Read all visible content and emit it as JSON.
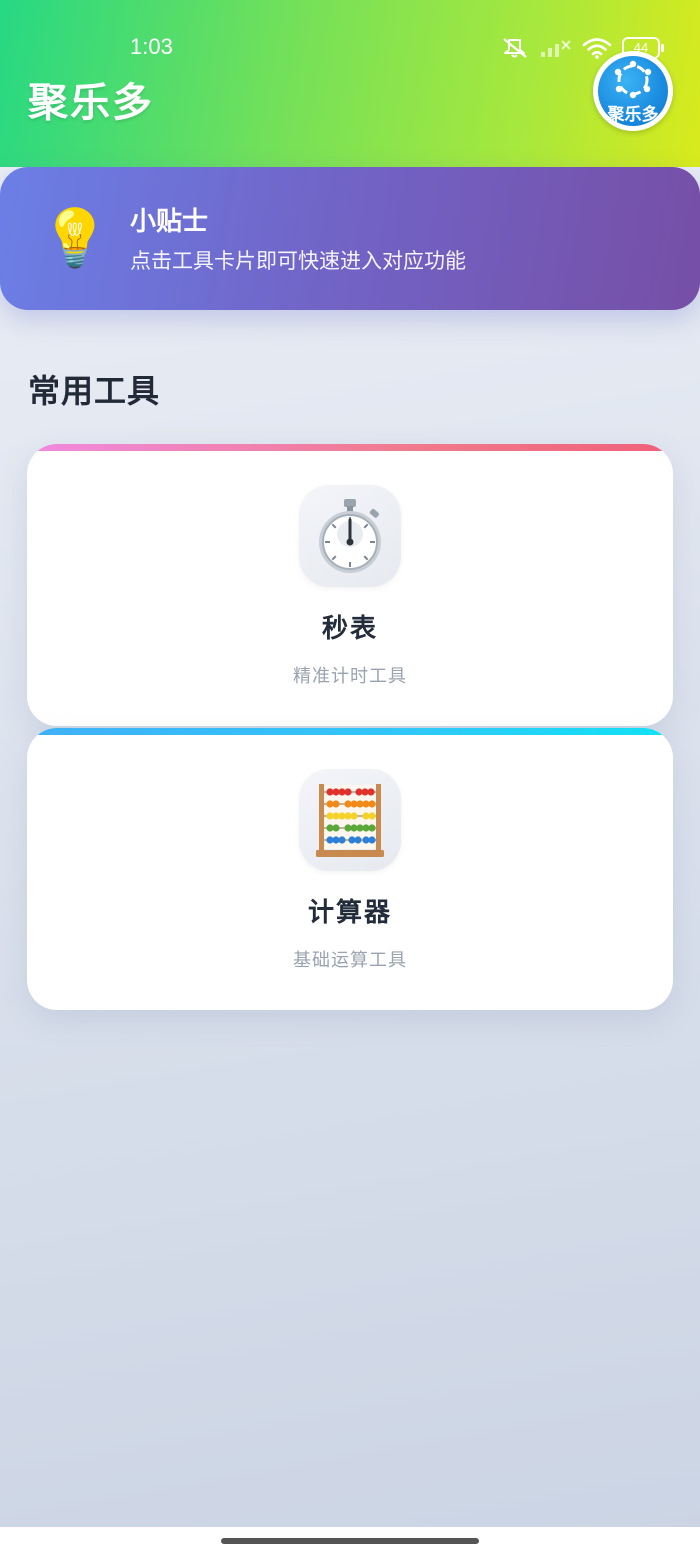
{
  "status_bar": {
    "time": "1:03",
    "battery": "44",
    "icons": [
      "mute-icon",
      "signal-icon",
      "wifi-icon",
      "battery-icon"
    ]
  },
  "header": {
    "title": "聚乐多",
    "logo_text": "聚乐多"
  },
  "tip": {
    "icon": "💡",
    "title": "小贴士",
    "description": "点击工具卡片即可快速进入对应功能"
  },
  "section": {
    "title": "常用工具"
  },
  "tools": [
    {
      "icon": "stopwatch-icon",
      "name": "秒表",
      "description": "精准计时工具"
    },
    {
      "icon": "abacus-icon",
      "name": "计算器",
      "description": "基础运算工具"
    }
  ],
  "colors": {
    "header_gradient": [
      "#27d883",
      "#72e05a",
      "#d9ea1c"
    ],
    "tip_gradient": [
      "#6b7fe6",
      "#764fa6"
    ],
    "stopwatch_accent": [
      "#f08ae0",
      "#f0607a"
    ],
    "calculator_accent": [
      "#40b0f8",
      "#10e2f4"
    ]
  }
}
